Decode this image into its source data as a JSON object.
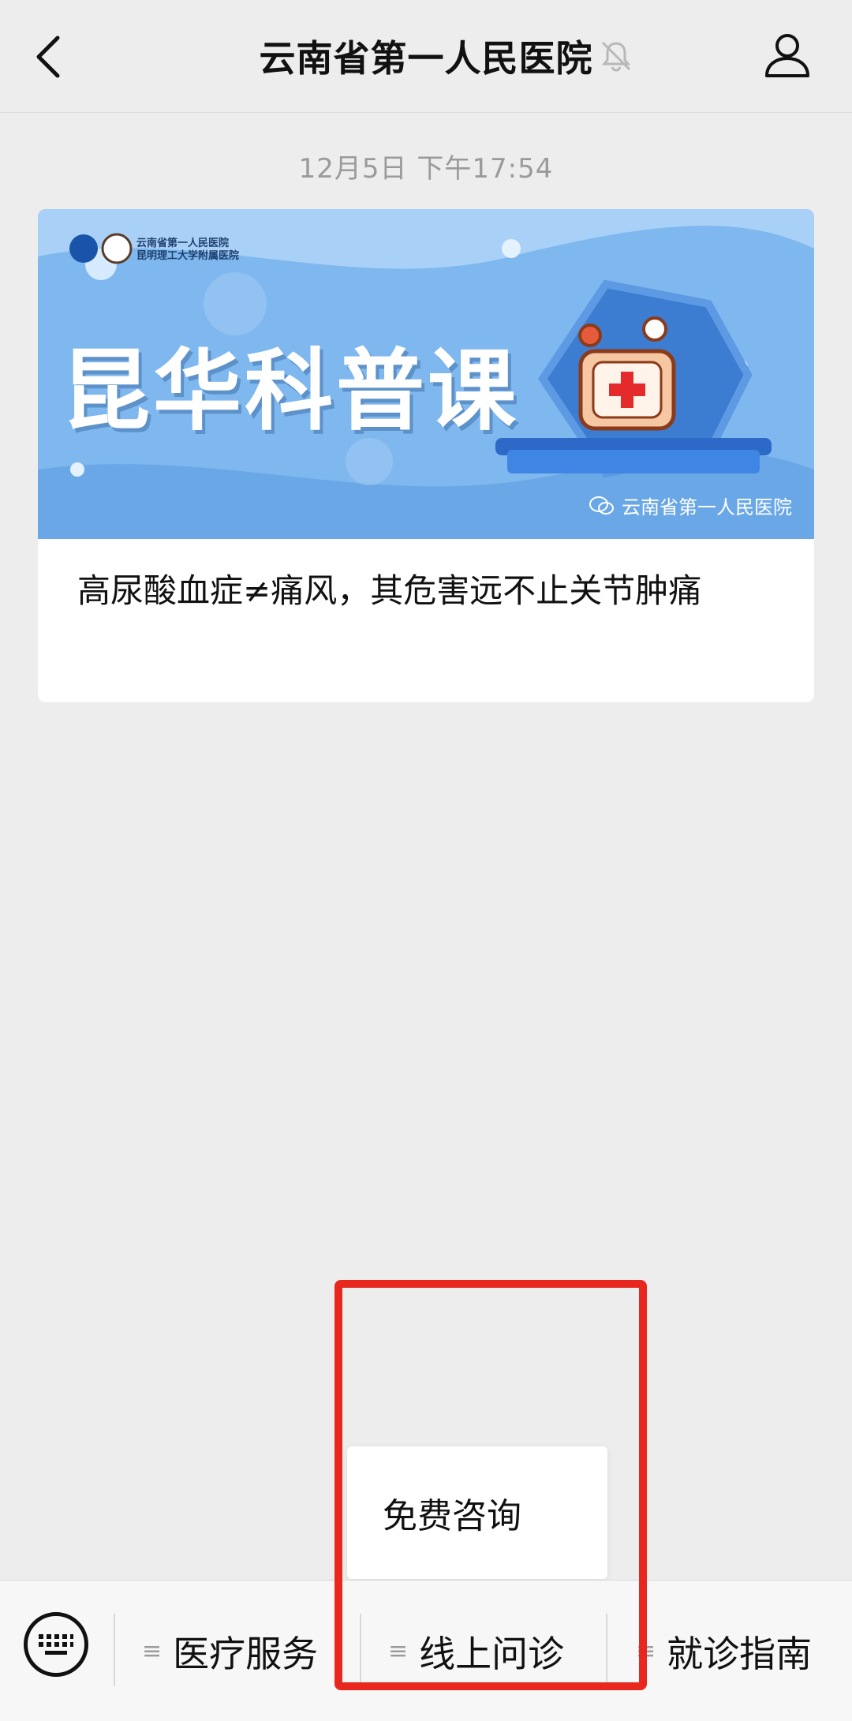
{
  "header": {
    "title": "云南省第一人民医院"
  },
  "chat": {
    "timestamp": "12月5日 下午17:54",
    "article": {
      "banner_title": "昆华科普课",
      "banner_logo_line1": "云南省第一人民医院",
      "banner_logo_line2": "昆明理工大学附属医院",
      "banner_source": "云南省第一人民医院",
      "caption": "高尿酸血症≠痛风，其危害远不止关节肿痛"
    }
  },
  "submenu": {
    "items": [
      "免费咨询"
    ]
  },
  "menubar": {
    "items": [
      {
        "label": "医疗服务"
      },
      {
        "label": "线上问诊"
      },
      {
        "label": "就诊指南"
      }
    ]
  },
  "colors": {
    "highlight": "#e8281f",
    "banner_bg": "#7fb7ef"
  }
}
